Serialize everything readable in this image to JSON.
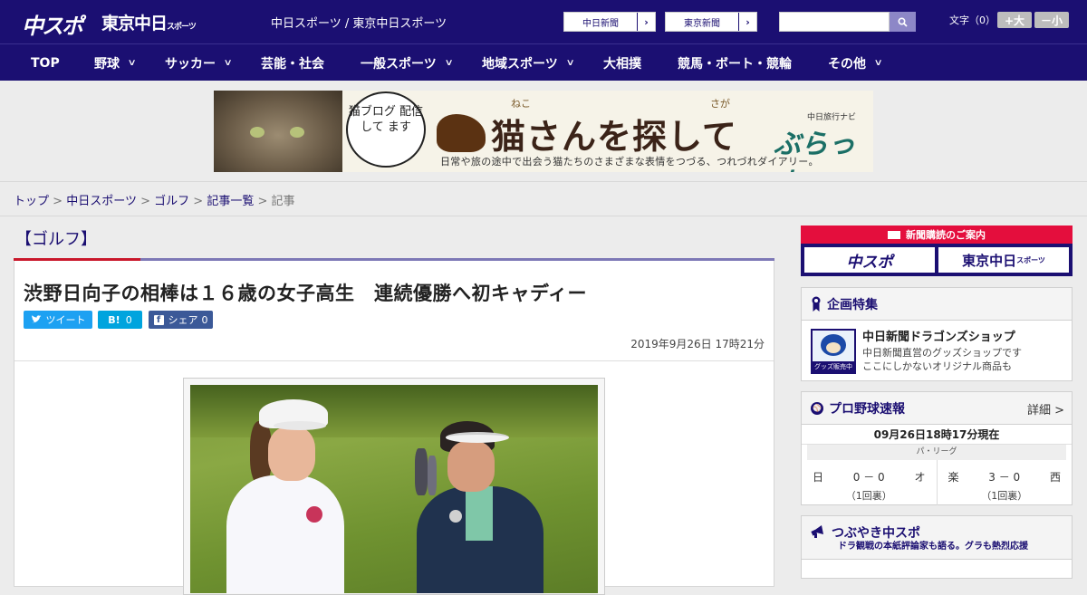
{
  "header": {
    "logo_main": "中スポ",
    "logo_tokyo": "東京中日",
    "logo_tokyo_suffix": "スポーツ",
    "site_links": "中日スポーツ / 東京中日スポーツ",
    "select_chunichi": "中日新聞",
    "select_tokyo": "東京新聞",
    "search_placeholder": "",
    "font_size_label": "文字（0）",
    "font_plus": "+大",
    "font_minus": "－小"
  },
  "nav": [
    {
      "label": "TOP",
      "has_dropdown": false
    },
    {
      "label": "野球",
      "has_dropdown": true
    },
    {
      "label": "サッカー",
      "has_dropdown": true
    },
    {
      "label": "芸能・社会",
      "has_dropdown": false
    },
    {
      "label": "一般スポーツ",
      "has_dropdown": true
    },
    {
      "label": "地域スポーツ",
      "has_dropdown": true
    },
    {
      "label": "大相撲",
      "has_dropdown": false
    },
    {
      "label": "競馬・ボート・競輪",
      "has_dropdown": false
    },
    {
      "label": "その他",
      "has_dropdown": true
    }
  ],
  "banner": {
    "bubble_text": "猫ブログ 配信して ます",
    "title": "猫さんを探して",
    "ruby_1": "ねこ",
    "ruby_2": "さが",
    "brand_small": "中日旅行ナビ",
    "brand": "ぶらっ人",
    "subtitle": "日常や旅の途中で出会う猫たちのさまざまな表情をつづる、つれづれダイアリー。"
  },
  "breadcrumb": {
    "items": [
      "トップ",
      "中日スポーツ",
      "ゴルフ",
      "記事一覧"
    ],
    "separator": ">",
    "current": "記事"
  },
  "article": {
    "category": "【ゴルフ】",
    "title": "渋野日向子の相棒は１６歳の女子高生　連続優勝へ初キャディー",
    "tweet_label": "ツイート",
    "hatena_label": "B!",
    "hatena_count": "0",
    "share_label": "シェア",
    "share_count": "0",
    "date": "2019年9月26日 17時21分"
  },
  "sidebar": {
    "subscription_title": "新聞購読のご案内",
    "sub_logo_1": "中スポ",
    "sub_logo_2": "東京中日",
    "sub_logo_2_suffix": "スポーツ",
    "feature_title": "企画特集",
    "shop_thumb_label": "グッズ販売中",
    "shop_title": "中日新聞ドラゴンズショップ",
    "shop_desc_1": "中日新聞直営のグッズショップです",
    "shop_desc_2": "ここにしかないオリジナル商品も",
    "baseball_title": "プロ野球速報",
    "baseball_more": "詳細 >",
    "baseball_time": "09月26日18時17分現在",
    "league": "パ・リーグ",
    "games": [
      {
        "home": "日",
        "score": "0 － 0",
        "away": "オ",
        "inning": "（1回裏）"
      },
      {
        "home": "楽",
        "score": "3 － 0",
        "away": "西",
        "inning": "（1回裏）"
      }
    ],
    "tsubuyaki_title": "つぶやき中スポ",
    "tsubuyaki_sub": "ドラ観戦の本紙評論家も語る。グラも熱烈応援"
  },
  "colors": {
    "brand_navy": "#1b0f72",
    "accent_red": "#e40e3d",
    "twitter": "#1da1f2",
    "hatena": "#00a4de",
    "facebook": "#3b5998"
  }
}
